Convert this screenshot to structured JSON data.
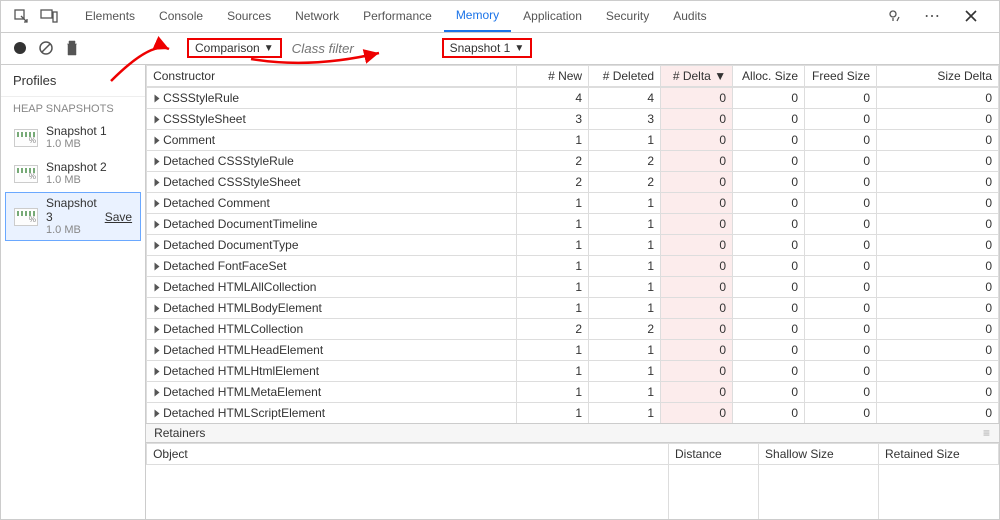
{
  "tabs": [
    "Elements",
    "Console",
    "Sources",
    "Network",
    "Performance",
    "Memory",
    "Application",
    "Security",
    "Audits"
  ],
  "active_tab": "Memory",
  "toolbar": {
    "view_mode": "Comparison",
    "class_filter_placeholder": "Class filter",
    "baseline": "Snapshot 1"
  },
  "sidebar": {
    "title": "Profiles",
    "section": "HEAP SNAPSHOTS",
    "snapshots": [
      {
        "name": "Snapshot 1",
        "size": "1.0 MB"
      },
      {
        "name": "Snapshot 2",
        "size": "1.0 MB"
      },
      {
        "name": "Snapshot 3",
        "size": "1.0 MB",
        "selected": true,
        "save": "Save"
      }
    ]
  },
  "grid": {
    "columns": [
      "Constructor",
      "# New",
      "# Deleted",
      "# Delta",
      "Alloc. Size",
      "Freed Size",
      "Size Delta"
    ],
    "sort_col": "# Delta",
    "rows": [
      {
        "c": "CSSStyleRule",
        "n": 4,
        "d": 4,
        "delta": 0,
        "a": 0,
        "f": 0,
        "s": 0
      },
      {
        "c": "CSSStyleSheet",
        "n": 3,
        "d": 3,
        "delta": 0,
        "a": 0,
        "f": 0,
        "s": 0
      },
      {
        "c": "Comment",
        "n": 1,
        "d": 1,
        "delta": 0,
        "a": 0,
        "f": 0,
        "s": 0
      },
      {
        "c": "Detached CSSStyleRule",
        "n": 2,
        "d": 2,
        "delta": 0,
        "a": 0,
        "f": 0,
        "s": 0
      },
      {
        "c": "Detached CSSStyleSheet",
        "n": 2,
        "d": 2,
        "delta": 0,
        "a": 0,
        "f": 0,
        "s": 0
      },
      {
        "c": "Detached Comment",
        "n": 1,
        "d": 1,
        "delta": 0,
        "a": 0,
        "f": 0,
        "s": 0
      },
      {
        "c": "Detached DocumentTimeline",
        "n": 1,
        "d": 1,
        "delta": 0,
        "a": 0,
        "f": 0,
        "s": 0
      },
      {
        "c": "Detached DocumentType",
        "n": 1,
        "d": 1,
        "delta": 0,
        "a": 0,
        "f": 0,
        "s": 0
      },
      {
        "c": "Detached FontFaceSet",
        "n": 1,
        "d": 1,
        "delta": 0,
        "a": 0,
        "f": 0,
        "s": 0
      },
      {
        "c": "Detached HTMLAllCollection",
        "n": 1,
        "d": 1,
        "delta": 0,
        "a": 0,
        "f": 0,
        "s": 0
      },
      {
        "c": "Detached HTMLBodyElement",
        "n": 1,
        "d": 1,
        "delta": 0,
        "a": 0,
        "f": 0,
        "s": 0
      },
      {
        "c": "Detached HTMLCollection",
        "n": 2,
        "d": 2,
        "delta": 0,
        "a": 0,
        "f": 0,
        "s": 0
      },
      {
        "c": "Detached HTMLHeadElement",
        "n": 1,
        "d": 1,
        "delta": 0,
        "a": 0,
        "f": 0,
        "s": 0
      },
      {
        "c": "Detached HTMLHtmlElement",
        "n": 1,
        "d": 1,
        "delta": 0,
        "a": 0,
        "f": 0,
        "s": 0
      },
      {
        "c": "Detached HTMLMetaElement",
        "n": 1,
        "d": 1,
        "delta": 0,
        "a": 0,
        "f": 0,
        "s": 0
      },
      {
        "c": "Detached HTMLScriptElement",
        "n": 1,
        "d": 1,
        "delta": 0,
        "a": 0,
        "f": 0,
        "s": 0
      }
    ]
  },
  "retainers": {
    "label": "Retainers",
    "columns": [
      "Object",
      "Distance",
      "Shallow Size",
      "Retained Size"
    ]
  }
}
